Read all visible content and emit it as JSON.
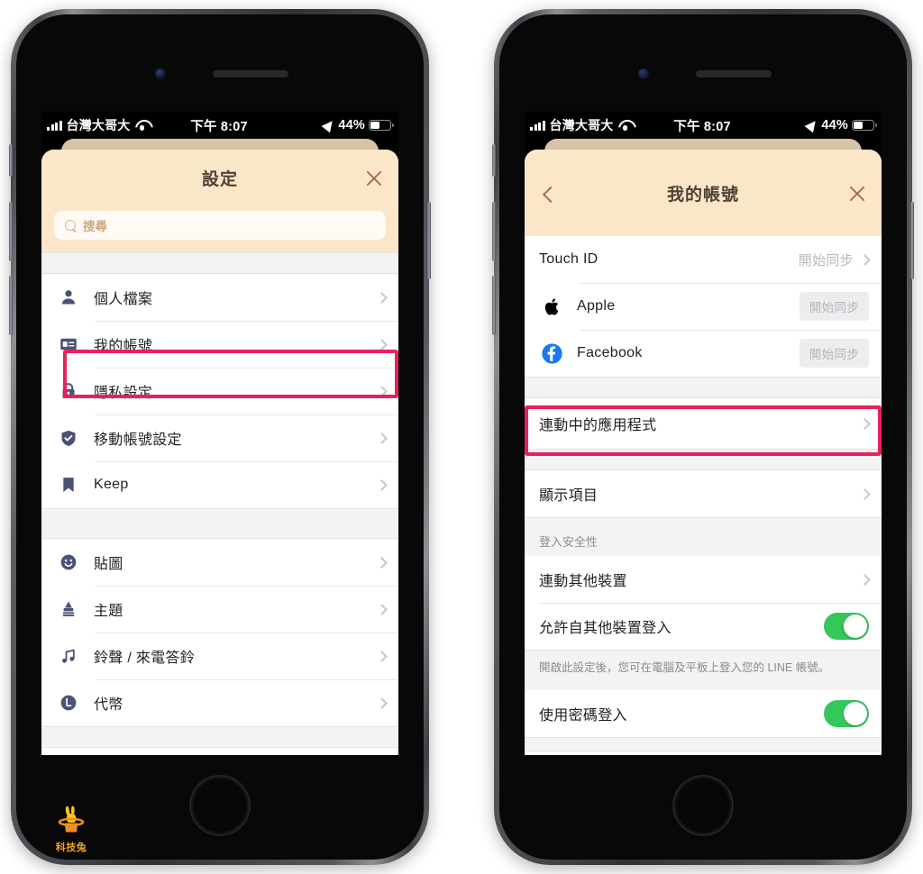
{
  "statusbar": {
    "carrier": "台灣大哥大",
    "time": "下午 8:07",
    "battery_pct": "44%",
    "signal_icon": "cellular-bars-icon",
    "wifi_icon": "wifi-icon",
    "location_icon": "location-arrow-icon",
    "battery_icon": "battery-icon"
  },
  "colors": {
    "header_bg": "#fce6c8",
    "header_back_card": "#d7c4a8",
    "header_text": "#4d4135",
    "icon_navy": "#4a5275",
    "highlight_red": "#e8215a",
    "toggle_green": "#34c759",
    "facebook_blue": "#1877f2",
    "watermark_orange": "#f0a323"
  },
  "left_phone": {
    "header": {
      "title": "設定",
      "close_label": "close-icon"
    },
    "search": {
      "placeholder": "搜尋",
      "icon": "search-icon"
    },
    "group_one": [
      {
        "label": "個人檔案",
        "icon": "person-icon",
        "chevron": true,
        "highlighted": false
      },
      {
        "label": "我的帳號",
        "icon": "id-card-icon",
        "chevron": true,
        "highlighted": true
      },
      {
        "label": "隱私設定",
        "icon": "lock-icon",
        "chevron": true,
        "highlighted": false
      },
      {
        "label": "移動帳號設定",
        "icon": "shield-check-icon",
        "chevron": true,
        "highlighted": false
      },
      {
        "label": "Keep",
        "icon": "bookmark-icon",
        "chevron": true,
        "highlighted": false
      }
    ],
    "group_two": [
      {
        "label": "貼圖",
        "icon": "smiley-icon",
        "chevron": true
      },
      {
        "label": "主題",
        "icon": "brush-icon",
        "chevron": true
      },
      {
        "label": "鈴聲 / 來電答鈴",
        "icon": "music-note-icon",
        "chevron": true
      },
      {
        "label": "代幣",
        "icon": "coin-l-icon",
        "chevron": true
      }
    ]
  },
  "right_phone": {
    "header": {
      "title": "我的帳號",
      "back_label": "back-chevron-icon",
      "close_label": "close-icon"
    },
    "accounts": [
      {
        "label": "Touch ID",
        "icon": null,
        "value": "開始同步",
        "chevron": true,
        "pill": null
      },
      {
        "label": "Apple",
        "icon": "apple-logo-icon",
        "value": null,
        "chevron": false,
        "pill": "開始同步"
      },
      {
        "label": "Facebook",
        "icon": "facebook-logo-icon",
        "value": null,
        "chevron": false,
        "pill": "開始同步"
      }
    ],
    "linked_apps": {
      "label": "連動中的應用程式",
      "chevron": true,
      "highlighted": true
    },
    "display_items": {
      "label": "顯示項目",
      "chevron": true
    },
    "security_caption": "登入安全性",
    "security_rows": [
      {
        "label": "連動其他裝置",
        "type": "chevron"
      },
      {
        "label": "允許自其他裝置登入",
        "type": "toggle",
        "on": true
      }
    ],
    "security_footnote": "開啟此設定後，您可在電腦及平板上登入您的 LINE 帳號。",
    "password_row": {
      "label": "使用密碼登入",
      "type": "toggle",
      "on": true
    }
  },
  "watermark": {
    "text": "科技兔",
    "icon": "rabbit-in-hat-icon"
  }
}
